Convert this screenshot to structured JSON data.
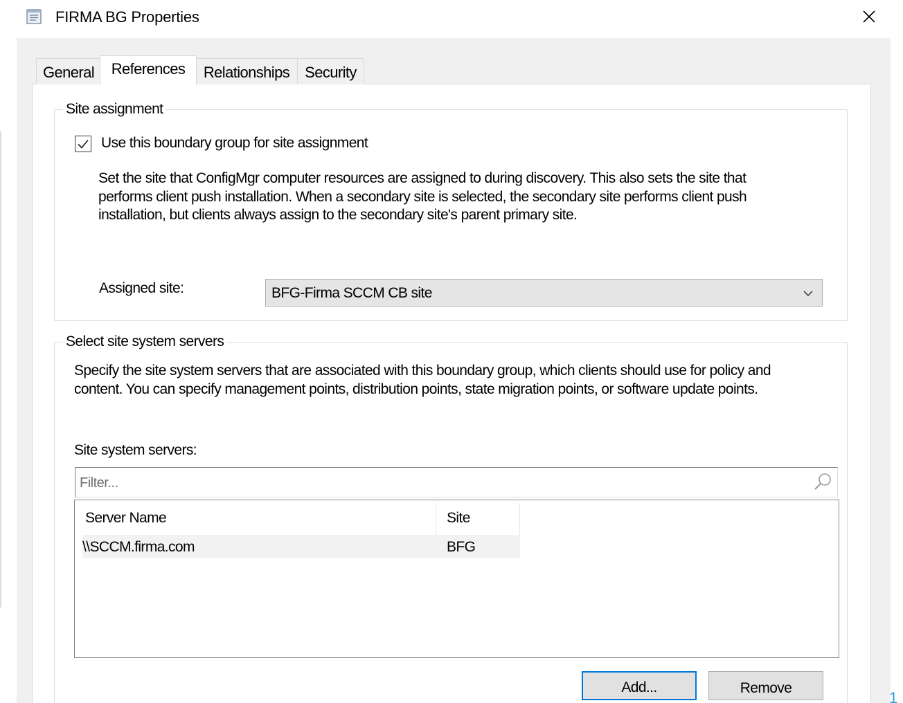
{
  "window": {
    "title": "FIRMA BG Properties",
    "corner_text": "1"
  },
  "tabs": [
    {
      "label": "General"
    },
    {
      "label": "References"
    },
    {
      "label": "Relationships"
    },
    {
      "label": "Security"
    }
  ],
  "site_assignment": {
    "group_label": "Site assignment",
    "checkbox_label": "Use this boundary group for site assignment",
    "checkbox_checked": true,
    "description_lines": [
      "Set the site that ConfigMgr computer resources are assigned to during discovery. This also sets the site that",
      "performs client push installation. When a secondary site is selected, the secondary site performs client push",
      "installation, but clients always assign to the secondary site's parent primary site."
    ],
    "assigned_label": "Assigned site:",
    "assigned_value": "BFG-Firma SCCM CB site"
  },
  "site_system_servers": {
    "group_label": "Select site system servers",
    "description_lines": [
      "Specify the site system servers that are associated with this boundary group, which clients should use for policy and",
      "content. You can specify management points, distribution points, state migration points, or software update points."
    ],
    "list_label": "Site system servers:",
    "filter_placeholder": "Filter...",
    "columns": [
      "Server Name",
      "Site"
    ],
    "rows": [
      {
        "server": "\\\\SCCM.firma.com",
        "site": "BFG"
      }
    ],
    "add_label": "Add...",
    "remove_label": "Remove"
  },
  "colors": {
    "accent": "#0078d7",
    "dialog_bg": "#f0f0f0",
    "panel_bg": "#ffffff",
    "corner_digit": "#2a9fd6"
  },
  "icons": {
    "title": "properties-window-icon",
    "close": "close-icon",
    "checkbox": "check-icon",
    "dropdown": "chevron-down-icon",
    "filter": "search-icon"
  }
}
